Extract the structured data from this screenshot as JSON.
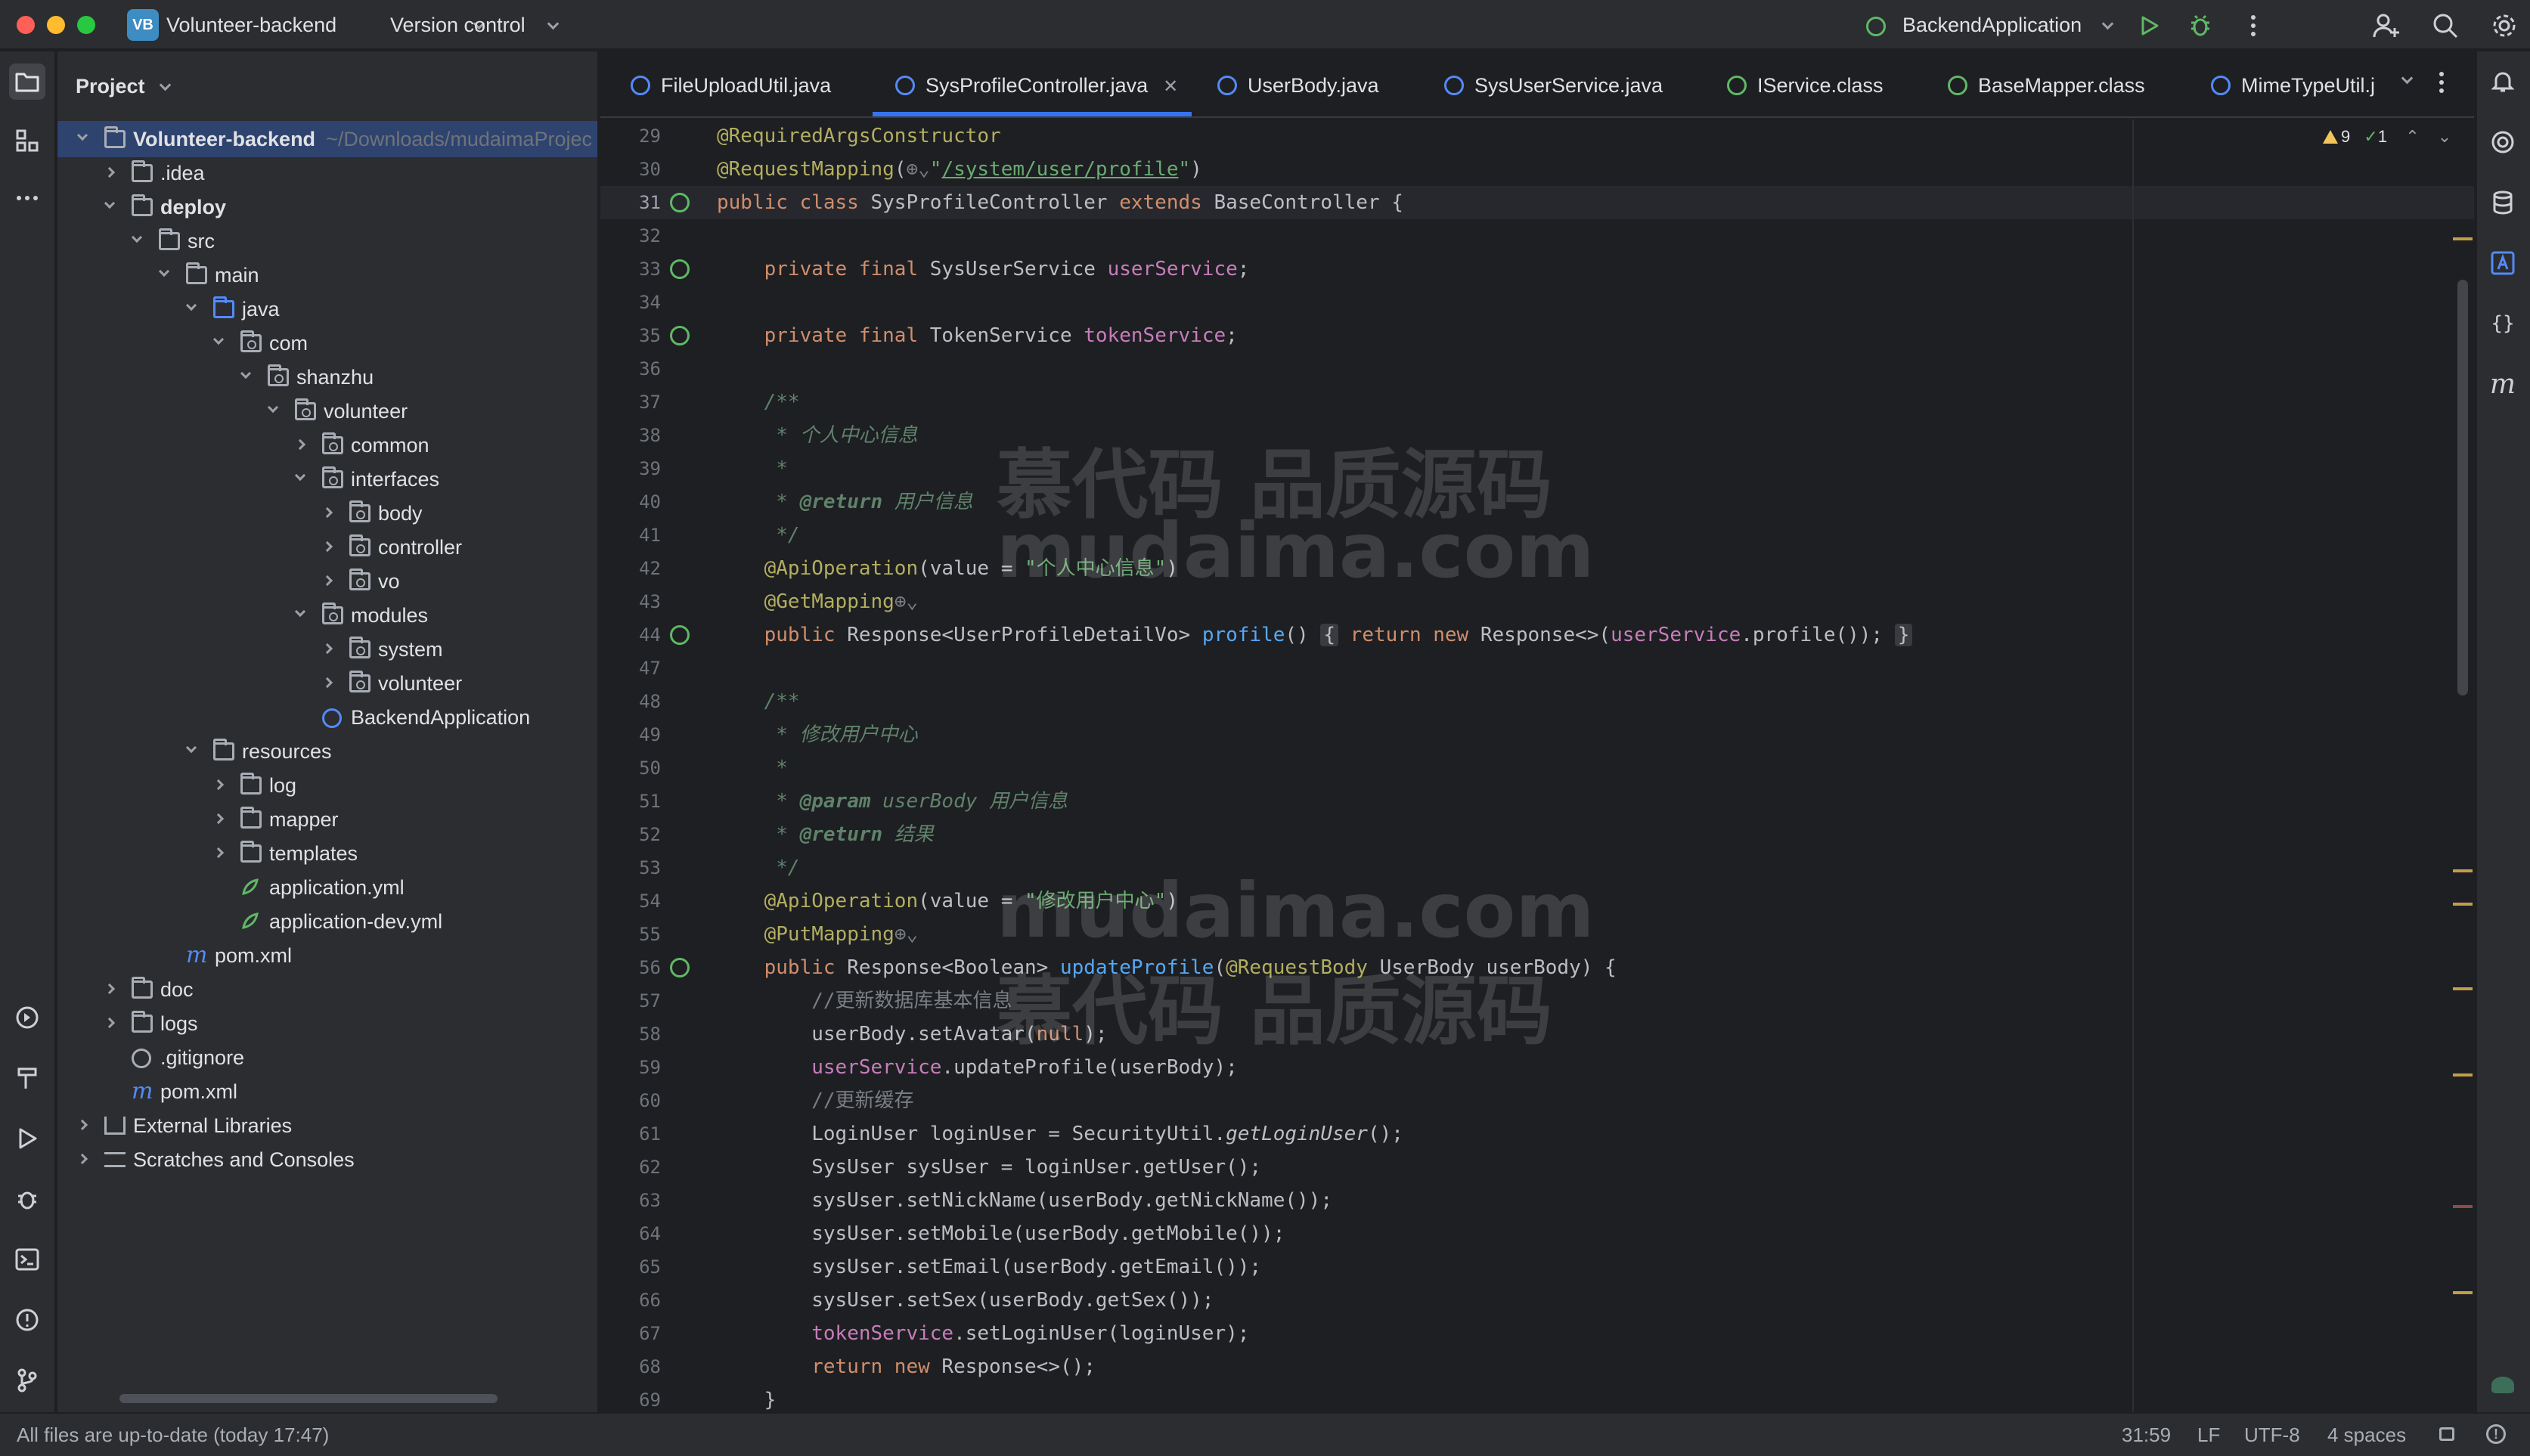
{
  "titlebar": {
    "project_badge": "VB",
    "project_name": "Volunteer-backend",
    "vcs_label": "Version control",
    "run_config": "BackendApplication",
    "colors": {
      "close": "#ff5f57",
      "minimize": "#febc2e",
      "maximize": "#28c840",
      "badge": "#3d8cc2"
    }
  },
  "project_panel": {
    "title": "Project",
    "tree": [
      {
        "label": "Volunteer-backend",
        "path": "~/Downloads/mudaimaProjec",
        "bold": true
      },
      {
        "label": ".idea"
      },
      {
        "label": "deploy",
        "bold": true
      },
      {
        "label": "src"
      },
      {
        "label": "main"
      },
      {
        "label": "java"
      },
      {
        "label": "com"
      },
      {
        "label": "shanzhu"
      },
      {
        "label": "volunteer"
      },
      {
        "label": "common"
      },
      {
        "label": "interfaces"
      },
      {
        "label": "body"
      },
      {
        "label": "controller"
      },
      {
        "label": "vo"
      },
      {
        "label": "modules"
      },
      {
        "label": "system"
      },
      {
        "label": "volunteer"
      },
      {
        "label": "BackendApplication"
      },
      {
        "label": "resources"
      },
      {
        "label": "log"
      },
      {
        "label": "mapper"
      },
      {
        "label": "templates"
      },
      {
        "label": "application.yml"
      },
      {
        "label": "application-dev.yml"
      },
      {
        "label": "pom.xml"
      },
      {
        "label": "doc"
      },
      {
        "label": "logs"
      },
      {
        "label": ".gitignore"
      },
      {
        "label": "pom.xml"
      },
      {
        "label": "External Libraries"
      },
      {
        "label": "Scratches and Consoles"
      }
    ]
  },
  "tabs": [
    {
      "label": "FileUploadUtil.java"
    },
    {
      "label": "SysProfileController.java",
      "active": true
    },
    {
      "label": "UserBody.java"
    },
    {
      "label": "SysUserService.java"
    },
    {
      "label": "IService.class"
    },
    {
      "label": "BaseMapper.class"
    },
    {
      "label": "MimeTypeUtil.j"
    }
  ],
  "inspections": {
    "warnings": "9",
    "ok": "1"
  },
  "editor": {
    "line_numbers": [
      "29",
      "30",
      "31",
      "32",
      "33",
      "34",
      "35",
      "36",
      "37",
      "38",
      "39",
      "40",
      "41",
      "42",
      "43",
      "44",
      "47",
      "48",
      "49",
      "50",
      "51",
      "52",
      "53",
      "54",
      "55",
      "56",
      "57",
      "58",
      "59",
      "60",
      "61",
      "62",
      "63",
      "64",
      "65",
      "66",
      "67",
      "68",
      "69"
    ],
    "current_line": "31"
  },
  "watermark": {
    "line1": "慕代码 品质源码",
    "line2": "mudaima.com"
  },
  "statusbar": {
    "message": "All files are up-to-date (today 17:47)",
    "position": "31:59",
    "line_sep": "LF",
    "encoding": "UTF-8",
    "indent": "4 spaces"
  }
}
